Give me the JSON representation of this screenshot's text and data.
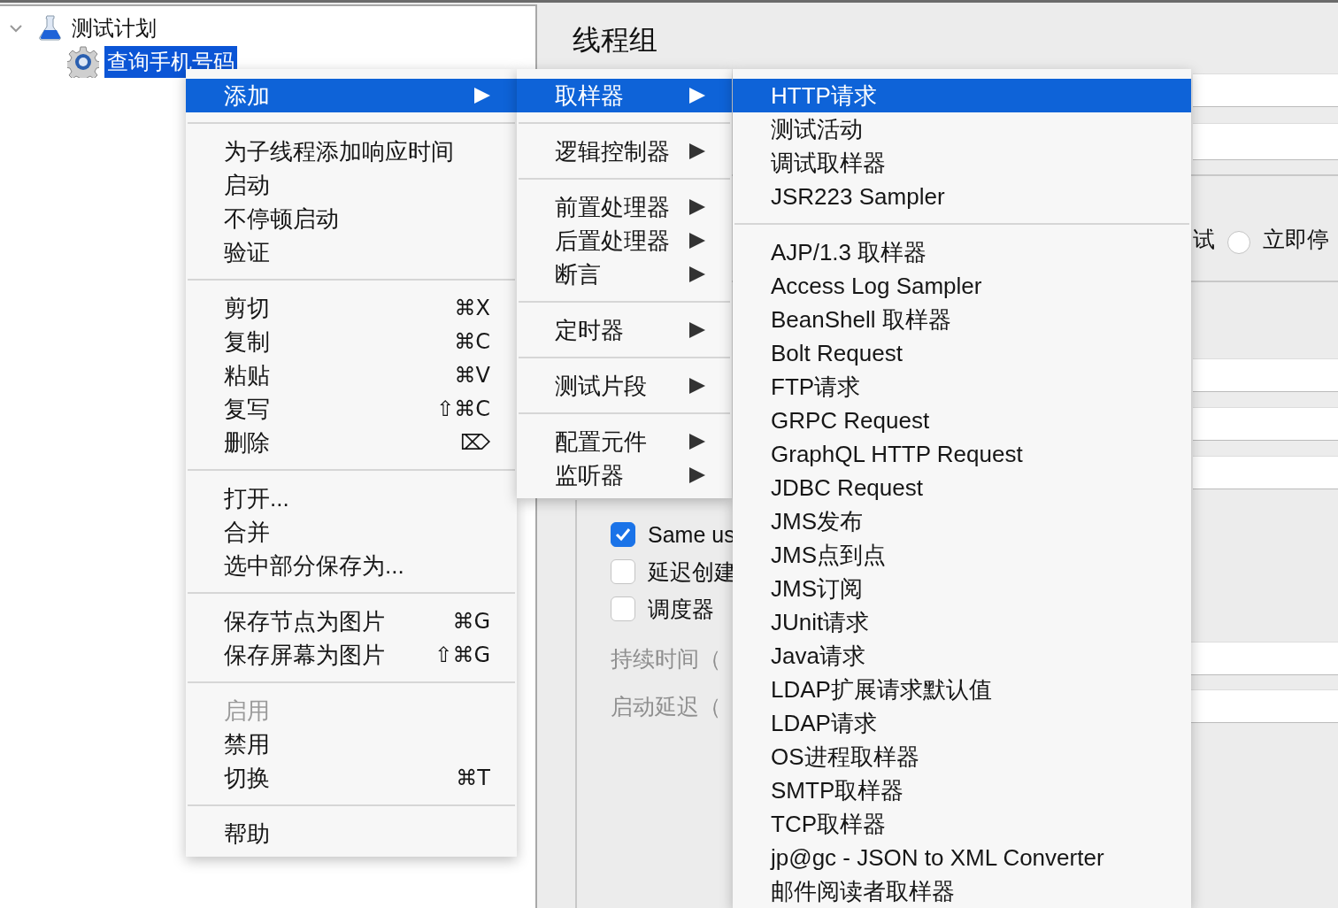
{
  "tree": [
    {
      "label": "测试计划",
      "expanded": true,
      "selected": false,
      "children": [
        {
          "label": "查询手机号码",
          "selected": true
        }
      ]
    }
  ],
  "panel": {
    "title": "线程组",
    "error_action": {
      "label_fragment": "试",
      "option": {
        "label": "立即停",
        "selected": false
      }
    },
    "checkboxes": [
      {
        "label": "Same us",
        "checked": true
      },
      {
        "label": "延迟创建",
        "checked": false
      },
      {
        "label": "调度器",
        "checked": false
      }
    ],
    "scheduler_fields": [
      {
        "label": "持续时间（"
      },
      {
        "label": "启动延迟（"
      }
    ]
  },
  "context_menu": {
    "sections": [
      [
        {
          "label": "添加",
          "submenu": true,
          "selected": true,
          "disabled": false
        }
      ],
      [
        {
          "label": "为子线程添加响应时间",
          "submenu": false,
          "selected": false,
          "disabled": false
        },
        {
          "label": "启动",
          "submenu": false,
          "selected": false,
          "disabled": false
        },
        {
          "label": "不停顿启动",
          "submenu": false,
          "selected": false,
          "disabled": false
        },
        {
          "label": "验证",
          "submenu": false,
          "selected": false,
          "disabled": false
        }
      ],
      [
        {
          "label": "剪切",
          "shortcut": "⌘X",
          "submenu": false,
          "selected": false,
          "disabled": false
        },
        {
          "label": "复制",
          "shortcut": "⌘C",
          "submenu": false,
          "selected": false,
          "disabled": false
        },
        {
          "label": "粘贴",
          "shortcut": "⌘V",
          "submenu": false,
          "selected": false,
          "disabled": false
        },
        {
          "label": "复写",
          "shortcut": "⇧⌘C",
          "submenu": false,
          "selected": false,
          "disabled": false
        },
        {
          "label": "删除",
          "shortcut": "⌦",
          "submenu": false,
          "selected": false,
          "disabled": false
        }
      ],
      [
        {
          "label": "打开...",
          "submenu": false,
          "selected": false,
          "disabled": false
        },
        {
          "label": "合并",
          "submenu": false,
          "selected": false,
          "disabled": false
        },
        {
          "label": "选中部分保存为...",
          "submenu": false,
          "selected": false,
          "disabled": false
        }
      ],
      [
        {
          "label": "保存节点为图片",
          "shortcut": "⌘G",
          "submenu": false,
          "selected": false,
          "disabled": false
        },
        {
          "label": "保存屏幕为图片",
          "shortcut": "⇧⌘G",
          "submenu": false,
          "selected": false,
          "disabled": false
        }
      ],
      [
        {
          "label": "启用",
          "submenu": false,
          "selected": false,
          "disabled": true
        },
        {
          "label": "禁用",
          "submenu": false,
          "selected": false,
          "disabled": false
        },
        {
          "label": "切换",
          "shortcut": "⌘T",
          "submenu": false,
          "selected": false,
          "disabled": false
        }
      ],
      [
        {
          "label": "帮助",
          "submenu": false,
          "selected": false,
          "disabled": false
        }
      ]
    ]
  },
  "add_menu": {
    "sections": [
      [
        {
          "label": "取样器",
          "submenu": true,
          "selected": true
        }
      ],
      [
        {
          "label": "逻辑控制器",
          "submenu": true,
          "selected": false
        }
      ],
      [
        {
          "label": "前置处理器",
          "submenu": true,
          "selected": false
        },
        {
          "label": "后置处理器",
          "submenu": true,
          "selected": false
        },
        {
          "label": "断言",
          "submenu": true,
          "selected": false
        }
      ],
      [
        {
          "label": "定时器",
          "submenu": true,
          "selected": false
        }
      ],
      [
        {
          "label": "测试片段",
          "submenu": true,
          "selected": false
        }
      ],
      [
        {
          "label": "配置元件",
          "submenu": true,
          "selected": false
        },
        {
          "label": "监听器",
          "submenu": true,
          "selected": false
        }
      ]
    ]
  },
  "sampler_menu": {
    "sections": [
      [
        {
          "label": "HTTP请求",
          "selected": true
        },
        {
          "label": "测试活动",
          "selected": false
        },
        {
          "label": "调试取样器",
          "selected": false
        },
        {
          "label": "JSR223 Sampler",
          "selected": false
        }
      ],
      [
        {
          "label": "AJP/1.3 取样器",
          "selected": false
        },
        {
          "label": "Access Log Sampler",
          "selected": false
        },
        {
          "label": "BeanShell 取样器",
          "selected": false
        },
        {
          "label": "Bolt Request",
          "selected": false
        },
        {
          "label": "FTP请求",
          "selected": false
        },
        {
          "label": "GRPC Request",
          "selected": false
        },
        {
          "label": "GraphQL HTTP Request",
          "selected": false
        },
        {
          "label": "JDBC Request",
          "selected": false
        },
        {
          "label": "JMS发布",
          "selected": false
        },
        {
          "label": "JMS点到点",
          "selected": false
        },
        {
          "label": "JMS订阅",
          "selected": false
        },
        {
          "label": "JUnit请求",
          "selected": false
        },
        {
          "label": "Java请求",
          "selected": false
        },
        {
          "label": "LDAP扩展请求默认值",
          "selected": false
        },
        {
          "label": "LDAP请求",
          "selected": false
        },
        {
          "label": "OS进程取样器",
          "selected": false
        },
        {
          "label": "SMTP取样器",
          "selected": false
        },
        {
          "label": "TCP取样器",
          "selected": false
        },
        {
          "label": "jp@gc - JSON to XML Converter",
          "selected": false
        },
        {
          "label": "邮件阅读者取样器",
          "selected": false
        }
      ]
    ]
  }
}
